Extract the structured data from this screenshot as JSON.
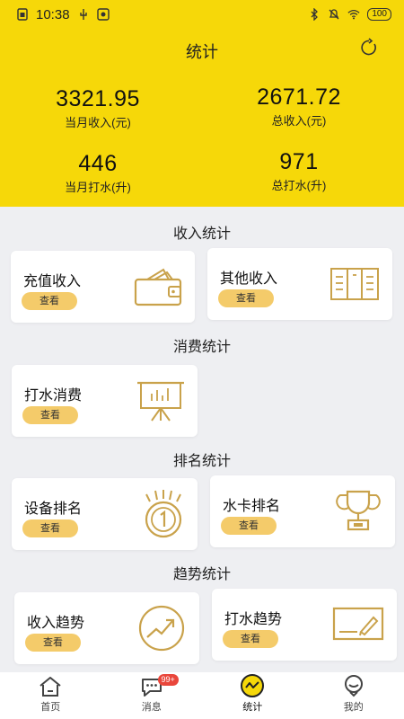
{
  "status_bar": {
    "time": "10:38",
    "battery": "100"
  },
  "header": {
    "title": "统计",
    "stats": [
      {
        "value": "3321.95",
        "label": "当月收入(元)"
      },
      {
        "value": "2671.72",
        "label": "总收入(元)"
      },
      {
        "value": "446",
        "label": "当月打水(升)"
      },
      {
        "value": "971",
        "label": "总打水(升)"
      }
    ]
  },
  "sections": {
    "income": {
      "title": "收入统计",
      "cards": [
        {
          "title": "充值收入",
          "button": "查看",
          "icon": "wallet-icon"
        },
        {
          "title": "其他收入",
          "button": "查看",
          "icon": "ledger-icon"
        }
      ]
    },
    "consume": {
      "title": "消费统计",
      "cards": [
        {
          "title": "打水消费",
          "button": "查看",
          "icon": "presentation-board-icon"
        }
      ]
    },
    "rank": {
      "title": "排名统计",
      "cards": [
        {
          "title": "设备排名",
          "button": "查看",
          "icon": "medal-icon"
        },
        {
          "title": "水卡排名",
          "button": "查看",
          "icon": "trophy-icon"
        }
      ]
    },
    "trend": {
      "title": "趋势统计",
      "cards": [
        {
          "title": "收入趋势",
          "button": "查看",
          "icon": "trend-chart-icon"
        },
        {
          "title": "打水趋势",
          "button": "查看",
          "icon": "edit-board-icon"
        }
      ]
    }
  },
  "tabbar": {
    "items": [
      {
        "label": "首页",
        "icon": "home-icon"
      },
      {
        "label": "消息",
        "icon": "message-icon",
        "badge": "99+"
      },
      {
        "label": "统计",
        "icon": "stats-icon",
        "active": true
      },
      {
        "label": "我的",
        "icon": "profile-icon"
      }
    ]
  },
  "colors": {
    "brand_yellow": "#f6d809",
    "button_yellow": "#f4cb6a",
    "icon_gold": "#c9a24b",
    "badge_red": "#e9463b"
  }
}
